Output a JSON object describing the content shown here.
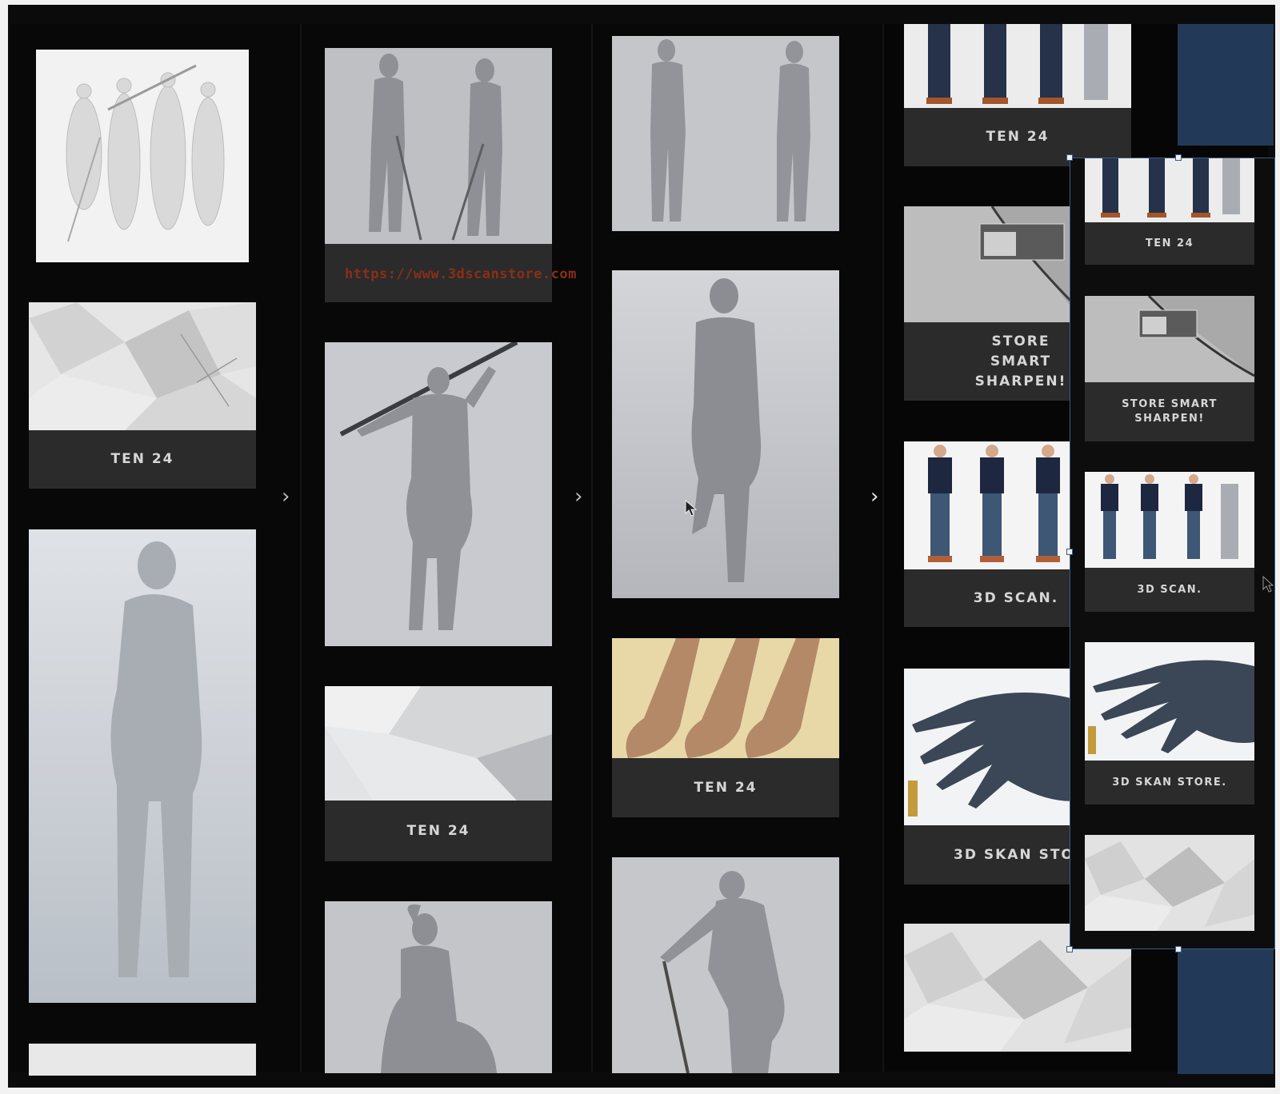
{
  "watermark": {
    "url": "https://www.3dscanstore.com"
  },
  "columns": {
    "c1": {
      "captions": {
        "ten24": "TEN 24"
      }
    },
    "c2": {
      "captions": {
        "ten24": "TEN 24"
      }
    },
    "c3": {
      "captions": {
        "ten24": "TEN 24"
      }
    },
    "c4": {
      "captions": {
        "ten24": "TEN 24",
        "sharpen": "STORE SMART SHARPEN!",
        "scan": "3D SCAN.",
        "skan": "3D SKAN STORE."
      }
    }
  },
  "overlay": {
    "captions": {
      "ten24": "TEN 24",
      "sharpen": "STORE SMART SHARPEN!",
      "scan": "3D SCAN.",
      "skan": "3D SKAN STORE."
    }
  },
  "icons": [
    "chevron-right-icon",
    "mouse-pointer-icon"
  ],
  "colors": {
    "background": "#0b0b0b",
    "caption_bg": "#2b2b2b",
    "caption_text": "#d6d6d6",
    "url": "#8a2f16",
    "selection": "#3a5b85",
    "navy": "#223a57"
  }
}
